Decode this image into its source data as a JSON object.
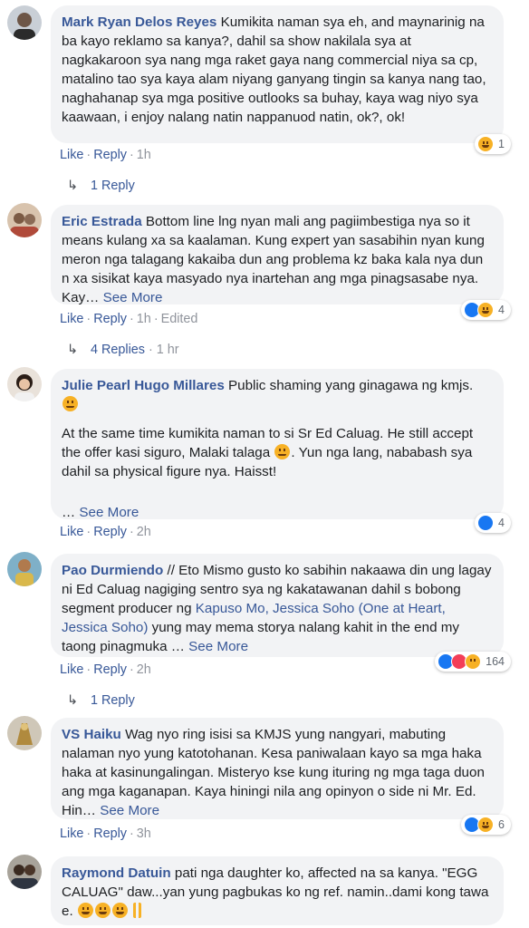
{
  "comments": [
    {
      "name": "Mark Ryan Delos Reyes",
      "text": "Kumikita naman sya eh, and maynarinig na ba kayo reklamo sa kanya?, dahil sa show nakilala sya at nagkakaroon sya nang mga raket gaya nang commercial niya sa cp, matalino tao sya kaya alam niyang ganyang tingin sa kanya nang tao, naghahanap sya mga positive outlooks sa buhay, kaya wag niyo sya kaawaan, i enjoy nalang natin nappanuod natin, ok?, ok!",
      "like": "Like",
      "reply": "Reply",
      "time": "1h",
      "reactions": [
        "haha"
      ],
      "reaction_count": "1",
      "replies_label": "1 Reply"
    },
    {
      "name": "Eric Estrada",
      "text": "Bottom line lng nyan mali ang pagiimbestiga nya so it means kulang xa sa kaalaman. Kung expert yan sasabihin nyan kung meron nga talagang kakaiba dun ang problema kz baka kala nya dun n xa sisikat kaya masyado nya inartehan ang mga pinagsasabe nya. Kay…",
      "see_more": "See More",
      "like": "Like",
      "reply": "Reply",
      "time": "1h",
      "edited": "Edited",
      "reactions": [
        "like",
        "haha"
      ],
      "reaction_count": "4",
      "replies_label": "4 Replies",
      "replies_time": "1 hr"
    },
    {
      "name": "Julie Pearl Hugo Millares",
      "text_1": "Public shaming yang ginagawa ng kmjs.",
      "text_2": "At the same time kumikita naman to si Sr Ed Caluag. He still accept the offer kasi siguro, Malaki talaga",
      "text_2b": ". Yun nga lang, nababash sya dahil sa physical figure nya. Haisst!",
      "ellipsis": "…",
      "see_more": "See More",
      "like": "Like",
      "reply": "Reply",
      "time": "2h",
      "reactions": [
        "like"
      ],
      "reaction_count": "4"
    },
    {
      "name": "Pao Durmiendo",
      "text_1": "// Eto Mismo gusto ko sabihin nakaawa din ung lagay ni Ed Caluag nagiging sentro sya ng kakatawanan dahil s bobong segment producer ng",
      "link": "Kapuso Mo, Jessica Soho (One at Heart, Jessica Soho)",
      "text_2": "yung may mema storya nalang kahit in the end my taong pinagmuka …",
      "see_more": "See More",
      "like": "Like",
      "reply": "Reply",
      "time": "2h",
      "reactions": [
        "like",
        "love",
        "sad"
      ],
      "reaction_count": "164",
      "replies_label": "1 Reply"
    },
    {
      "name": "VS Haiku",
      "text": "Wag nyo ring isisi sa KMJS yung nangyari, mabuting nalaman nyo yung katotohanan. Kesa paniwalaan kayo sa mga haka haka at kasinungalingan. Misteryo kse kung ituring ng mga taga duon ang mga kaganapan. Kaya hiningi nila ang opinyon o side ni Mr. Ed. Hin…",
      "see_more": "See More",
      "like": "Like",
      "reply": "Reply",
      "time": "3h",
      "reactions": [
        "like",
        "haha"
      ],
      "reaction_count": "6"
    },
    {
      "name": "Raymond Datuin",
      "text": "pati nga daughter ko, affected na sa kanya. \"EGG CALUAG\" daw...yan yung pagbukas ko ng ref. namin..dami kong tawa e."
    }
  ],
  "colors": {
    "name": "#385898",
    "bubble": "#f2f3f5",
    "meta": "#90949c"
  }
}
